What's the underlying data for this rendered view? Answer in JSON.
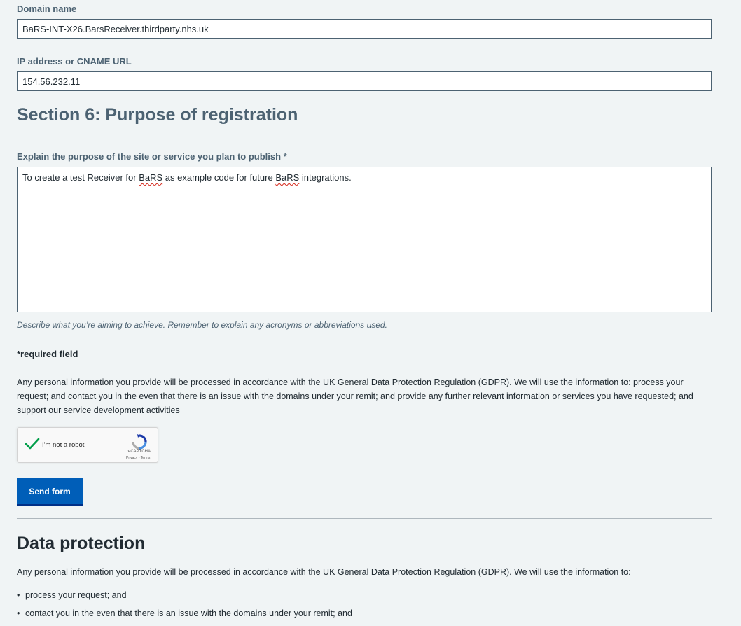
{
  "fields": {
    "domain": {
      "label": "Domain name",
      "value": "BaRS-INT-X26.BarsReceiver.thirdparty.nhs.uk"
    },
    "ip": {
      "label": "IP address or CNAME URL",
      "value": "154.56.232.11"
    }
  },
  "section6": {
    "heading": "Section 6: Purpose of registration",
    "purpose_label": "Explain the purpose of the site or service you plan to publish *",
    "purpose_value_parts": [
      "To create a test Receiver for ",
      "BaRS",
      " as example code for future ",
      "BaRS",
      " integrations."
    ],
    "hint": "Describe what you’re aiming to achieve. Remember to explain any acronyms or abbreviations used."
  },
  "required_note": "*required field",
  "gdpr_text": "Any personal information you provide will be processed in accordance with the UK General Data Protection Regulation (GDPR). We will use the information to: process your request; and contact you in the even that there is an issue with the domains under your remit; and provide any further relevant information or services you have requested; and support our service development activities",
  "captcha": {
    "label": "I'm not a robot",
    "brand": "reCAPTCHA",
    "privacy": "Privacy",
    "separator": " - ",
    "terms": "Terms",
    "checked": true
  },
  "submit_label": "Send form",
  "data_protection": {
    "heading": "Data protection",
    "intro": "Any personal information you provide will be processed in accordance with the UK General Data Protection Regulation (GDPR). We will use the information to:",
    "items": [
      "process your request;  and",
      "contact you in the even that there is an issue with the domains under your remit; and"
    ]
  },
  "colors": {
    "background": "#f0f4f5",
    "primary_button": "#005eb8",
    "heading_grey": "#4c6272",
    "check_green": "#009e49",
    "spellcheck": "#d5281b"
  },
  "icons": [
    "checkmark-icon",
    "recaptcha-logo-icon"
  ]
}
